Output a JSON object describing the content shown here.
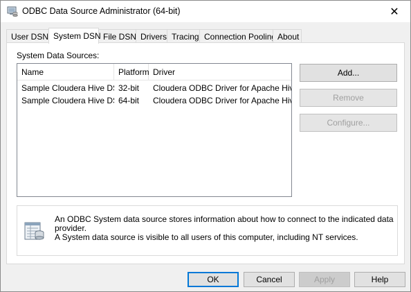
{
  "window": {
    "title": "ODBC Data Source Administrator (64-bit)",
    "close_glyph": "✕",
    "app_icon": "odbc-admin-icon"
  },
  "tabs": [
    {
      "label": "User DSN",
      "active": false
    },
    {
      "label": "System DSN",
      "active": true
    },
    {
      "label": "File DSN",
      "active": false
    },
    {
      "label": "Drivers",
      "active": false
    },
    {
      "label": "Tracing",
      "active": false
    },
    {
      "label": "Connection Pooling",
      "active": false
    },
    {
      "label": "About",
      "active": false
    }
  ],
  "panel": {
    "section_label": "System Data Sources:",
    "columns": [
      "Name",
      "Platform",
      "Driver"
    ],
    "rows": [
      {
        "name": "Sample Cloudera Hive DSN",
        "platform": "32-bit",
        "driver": "Cloudera ODBC Driver for Apache Hive"
      },
      {
        "name": "Sample Cloudera Hive DSN",
        "platform": "64-bit",
        "driver": "Cloudera ODBC Driver for Apache Hive"
      }
    ],
    "buttons": {
      "add": "Add...",
      "remove": "Remove",
      "configure": "Configure..."
    },
    "info": {
      "icon": "data-source-icon",
      "line1": "An ODBC System data source stores information about how to connect to the indicated data provider.",
      "line2": "A System data source is visible to all users of this computer, including NT services."
    }
  },
  "footer": {
    "ok": "OK",
    "cancel": "Cancel",
    "apply": "Apply",
    "help": "Help"
  },
  "colors": {
    "default_button_border": "#0078d7",
    "disabled_text": "#a0a0a0"
  }
}
